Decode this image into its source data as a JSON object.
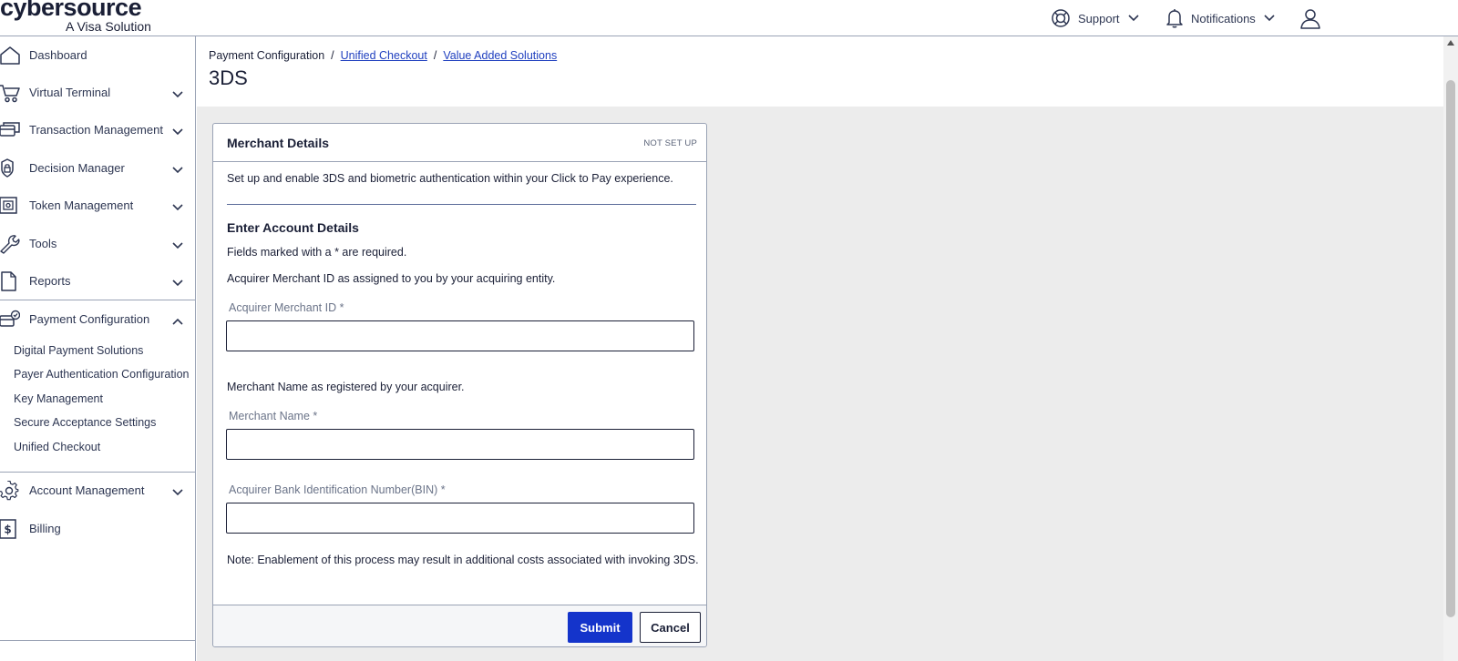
{
  "brand": {
    "name": "cybersource",
    "tagline": "A Visa Solution"
  },
  "header": {
    "support_label": "Support",
    "notifications_label": "Notifications"
  },
  "sidebar": {
    "items": [
      {
        "label": "Dashboard",
        "icon": "home-icon"
      },
      {
        "label": "Virtual Terminal",
        "icon": "cart-icon"
      },
      {
        "label": "Transaction Management",
        "icon": "cards-icon"
      },
      {
        "label": "Decision Manager",
        "icon": "shield-lock-icon"
      },
      {
        "label": "Token Management",
        "icon": "vault-icon"
      },
      {
        "label": "Tools",
        "icon": "wrench-icon"
      },
      {
        "label": "Reports",
        "icon": "document-icon"
      },
      {
        "label": "Payment Configuration",
        "icon": "card-check-icon"
      },
      {
        "label": "Account Management",
        "icon": "gear-icon"
      },
      {
        "label": "Billing",
        "icon": "dollar-receipt-icon"
      }
    ],
    "payment_config_subitems": [
      "Digital Payment Solutions",
      "Payer Authentication Configuration",
      "Key Management",
      "Secure Acceptance Settings",
      "Unified Checkout"
    ]
  },
  "page": {
    "breadcrumb": {
      "root": "Payment Configuration",
      "separator": "/",
      "link1": "Unified Checkout",
      "link2": "Value Added Solutions"
    },
    "title": "3DS"
  },
  "card": {
    "title": "Merchant Details",
    "status": "NOT SET UP",
    "intro": "Set up and enable 3DS and biometric authentication within your Click to Pay experience.",
    "section_title": "Enter Account Details",
    "required_note": "Fields marked with a * are required.",
    "merchant_id_help": "Acquirer Merchant ID as assigned to you by your acquiring entity.",
    "merchant_id_label": "Acquirer Merchant ID *",
    "merchant_id_value": "",
    "merchant_name_help": "Merchant Name as registered by your acquirer.",
    "merchant_name_label": "Merchant Name *",
    "merchant_name_value": "",
    "bin_label": "Acquirer Bank Identification Number(BIN) *",
    "bin_value": "",
    "note": "Note: Enablement of this process may result in additional costs associated with invoking 3DS.",
    "submit_label": "Submit",
    "cancel_label": "Cancel"
  },
  "colors": {
    "primary": "#1434cb",
    "link": "#1f3fbf",
    "text": "#1a1f36",
    "content_bg": "#ececec",
    "border": "#9aa3b5"
  }
}
